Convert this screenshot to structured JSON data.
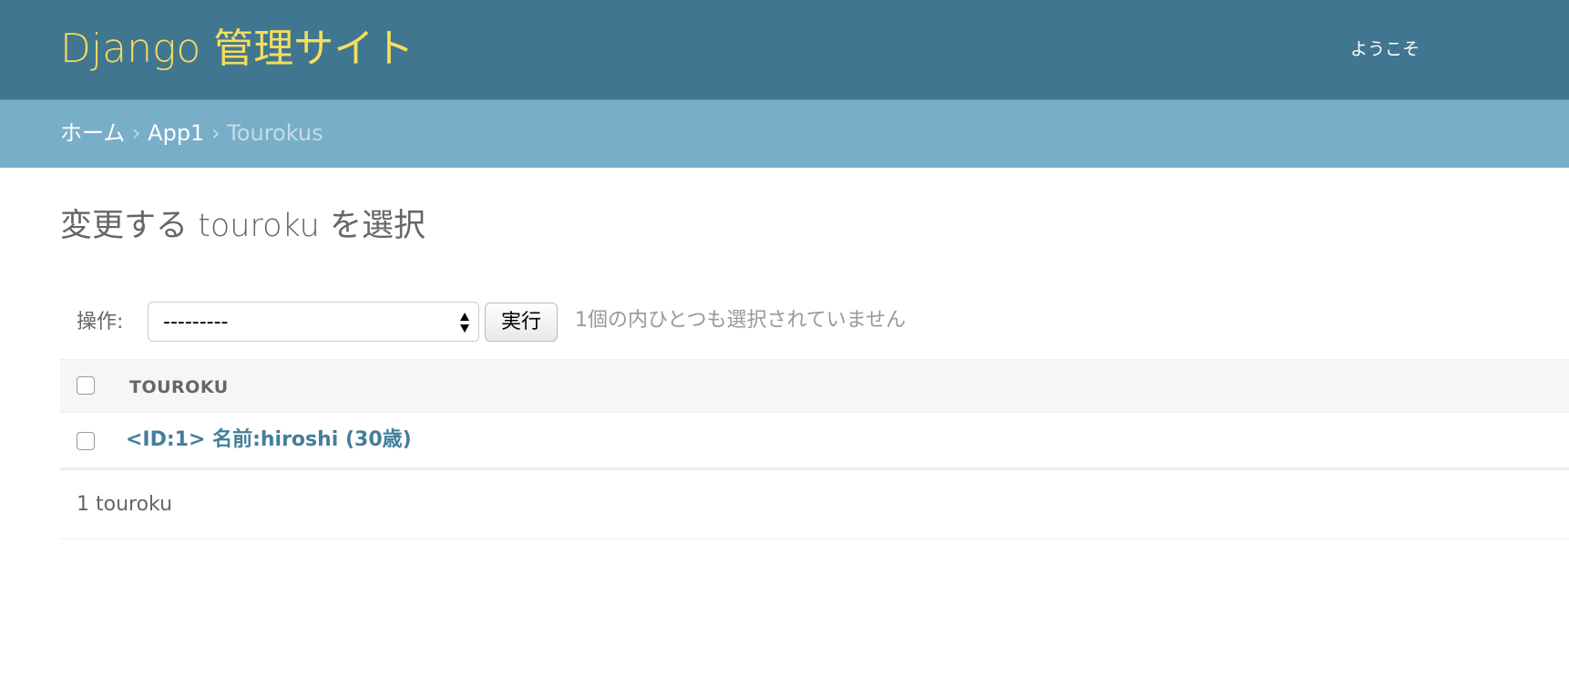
{
  "header": {
    "site_title": "Django 管理サイト",
    "user_tools": "ようこそ"
  },
  "breadcrumbs": {
    "home": "ホーム",
    "separator": "›",
    "app": "App1",
    "current": "Tourokus"
  },
  "content": {
    "title": "変更する touroku を選択"
  },
  "actions": {
    "label": "操作:",
    "selected_value": "---------",
    "go_label": "実行",
    "counter": "1個の内ひとつも選択されていません"
  },
  "table": {
    "column_header": "TOUROKU",
    "rows": [
      {
        "label": "<ID:1> 名前:hiroshi (30歳)"
      }
    ]
  },
  "paginator": {
    "text": "1 touroku"
  },
  "colors": {
    "header_bg": "#417690",
    "site_title": "#f5dd5d",
    "breadcrumbs_bg": "#79aec8",
    "link": "#447e9b"
  }
}
